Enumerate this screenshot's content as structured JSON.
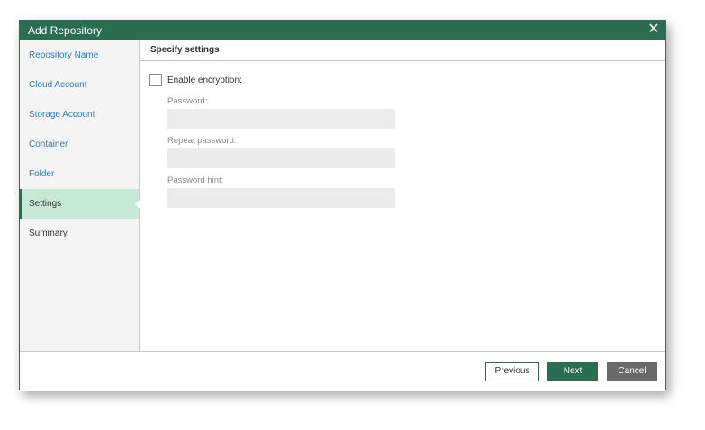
{
  "dialog": {
    "title": "Add Repository",
    "close_icon": "close-icon"
  },
  "sidebar": {
    "items": [
      {
        "label": "Repository Name"
      },
      {
        "label": "Cloud Account"
      },
      {
        "label": "Storage Account"
      },
      {
        "label": "Container"
      },
      {
        "label": "Folder"
      },
      {
        "label": "Settings",
        "active": true
      },
      {
        "label": "Summary"
      }
    ]
  },
  "main": {
    "section_title": "Specify settings",
    "enable_encryption_label": "Enable encryption:",
    "enable_encryption_checked": false,
    "password_label": "Password:",
    "password_value": "",
    "repeat_password_label": "Repeat password:",
    "repeat_password_value": "",
    "password_hint_label": "Password hint:",
    "password_hint_value": ""
  },
  "footer": {
    "previous_label": "Previous",
    "next_label": "Next",
    "cancel_label": "Cancel"
  },
  "colors": {
    "accent": "#2b6d51",
    "active_nav": "#c5e8d7",
    "link": "#2a7db5",
    "cancel": "#6a6a6a"
  }
}
